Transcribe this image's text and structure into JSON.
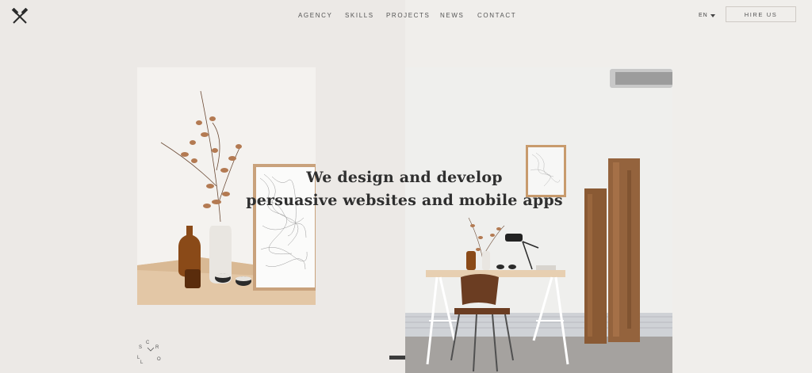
{
  "header": {
    "nav": [
      {
        "label": "AGENCY"
      },
      {
        "label": "SKILLS"
      },
      {
        "label": "PROJECTS"
      },
      {
        "label": "NEWS"
      },
      {
        "label": "CONTACT"
      }
    ],
    "language": "EN",
    "cta_label": "HIRE US",
    "logo_icon": "crossed-hammers-icon"
  },
  "hero": {
    "headline_line1": "We design and develop",
    "headline_line2": "persuasive websites and mobile apps"
  },
  "scroll": {
    "letters": [
      "S",
      "C",
      "R",
      "O",
      "L",
      "L"
    ],
    "icon": "chevron-down-icon"
  },
  "colors": {
    "background": "#ece9e6",
    "background_right": "#f0eeeb",
    "text": "#2f2f2f",
    "slide_indicator": "#3c3c3c"
  }
}
